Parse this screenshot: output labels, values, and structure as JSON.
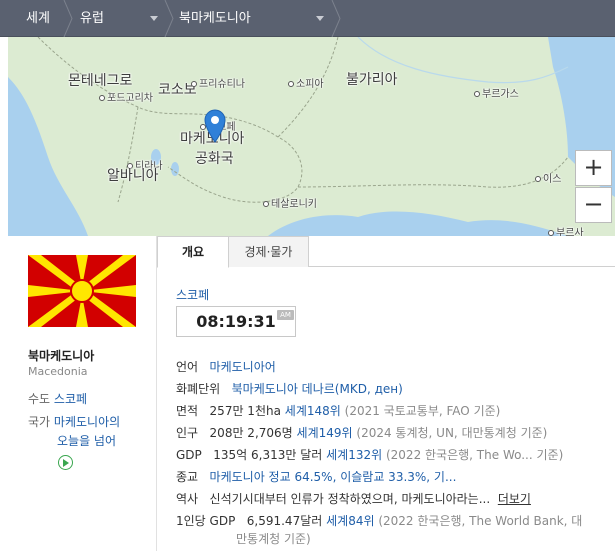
{
  "breadcrumb": {
    "level1": "세계",
    "level2": "유럽",
    "level3": "북마케도니아"
  },
  "map": {
    "labels": {
      "montenegro": "몬테네그로",
      "kosovo": "코소보",
      "pristina": "프리슈티나",
      "sofia": "소피아",
      "bulgaria": "불가리아",
      "podgorica": "포드고리차",
      "burgas": "부르가스",
      "skopje": "스코페",
      "macedonia_line1": "마케도니아",
      "macedonia_line2": "공화국",
      "tirana": "티라나",
      "albania": "알바니아",
      "istanbul_partial": "이스",
      "thessaloniki": "테살로니키",
      "bursa_partial": "부르사"
    },
    "zoom_in": "+",
    "zoom_out": "−",
    "colors": {
      "land": "#dcebd2",
      "sea": "#a9d0ee",
      "pin": "#2f80d8"
    }
  },
  "profile": {
    "name": "북마케도니아",
    "name_en": "Macedonia",
    "capital_label": "수도",
    "capital": "스코페",
    "anthem_label": "국가",
    "anthem_line1": "마케도니아의",
    "anthem_line2": "오늘을 넘어",
    "flag_colors": {
      "red": "#d20000",
      "yellow": "#ffe600"
    }
  },
  "tabs": [
    {
      "label": "개요"
    },
    {
      "label": "경제·물가"
    }
  ],
  "clock": {
    "city": "스코페",
    "time": "08:19:31",
    "ampm": "AM"
  },
  "facts": {
    "language": {
      "key": "언어",
      "value": "마케도니아어"
    },
    "currency": {
      "key": "화폐단위",
      "value": "북마케도니아 데나르(MKD, ден)"
    },
    "area": {
      "key": "면적",
      "value": "257만 1천ha",
      "rank": "세계148위",
      "source": "(2021 국토교통부, FAO 기준)"
    },
    "population": {
      "key": "인구",
      "value": "208만 2,706명",
      "rank": "세계149위",
      "source": "(2024 통계청, UN, 대만통계청 기준)"
    },
    "gdp": {
      "key": "GDP",
      "value": "135억 6,313만 달러",
      "rank": "세계132위",
      "source": "(2022 한국은행, The Wo...  기준)"
    },
    "religion": {
      "key": "종교",
      "value": "마케도니아 정교 64.5%, 이슬람교 33.3%, 기..."
    },
    "history": {
      "key": "역사",
      "value": "신석기시대부터 인류가 정착하였으며, 마케도니아라는...",
      "more": "더보기"
    },
    "gdp_per_capita": {
      "key": "1인당 GDP",
      "value": "6,591.47달러",
      "rank": "세계84위",
      "source_line1": "(2022 한국은행, The World Bank, 대",
      "source_line2": "만통계청 기준)"
    }
  }
}
